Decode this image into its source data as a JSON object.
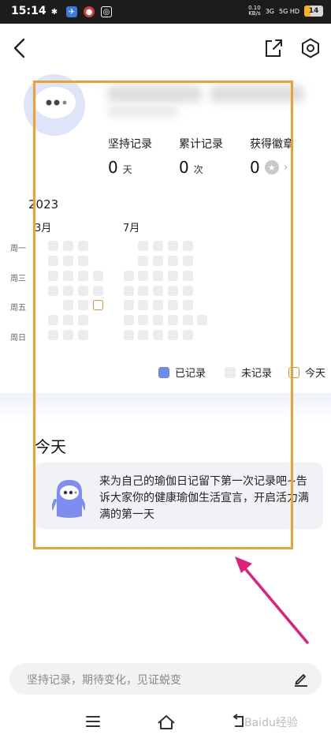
{
  "status_bar": {
    "time": "15:14",
    "net_speed": "0.10",
    "net_unit": "KB/s",
    "signal_1": "3G",
    "signal_2": "5G HD",
    "battery": "14"
  },
  "header": {
    "back_icon": "chevron-left-icon",
    "share_icon": "share-icon",
    "settings_icon": "settings-icon"
  },
  "stats": [
    {
      "label": "坚持记录",
      "value": "0",
      "unit": "天"
    },
    {
      "label": "累计记录",
      "value": "0",
      "unit": "次"
    },
    {
      "label": "获得徽章",
      "value": "0",
      "unit": ""
    }
  ],
  "calendar": {
    "year": "2023",
    "months": [
      "3月",
      "7月"
    ],
    "weekdays": [
      "周一",
      "周三",
      "周五",
      "周日"
    ]
  },
  "legend": [
    {
      "label": "已记录",
      "color": "#6f8bee"
    },
    {
      "label": "未记录",
      "color": "#ececee"
    },
    {
      "label": "今天",
      "color": "#e0922e"
    }
  ],
  "today": {
    "title": "今天",
    "message": "来为自己的瑜伽日记留下第一次记录吧~告诉大家你的健康瑜伽生活宣言，开启活力满满的第一天"
  },
  "input": {
    "placeholder": "坚持记录，期待变化，见证蜕变"
  },
  "watermark": "Baidu经验",
  "colors": {
    "highlight": "#f0a030",
    "arrow": "#e0207a",
    "accent": "#6f8bee"
  }
}
